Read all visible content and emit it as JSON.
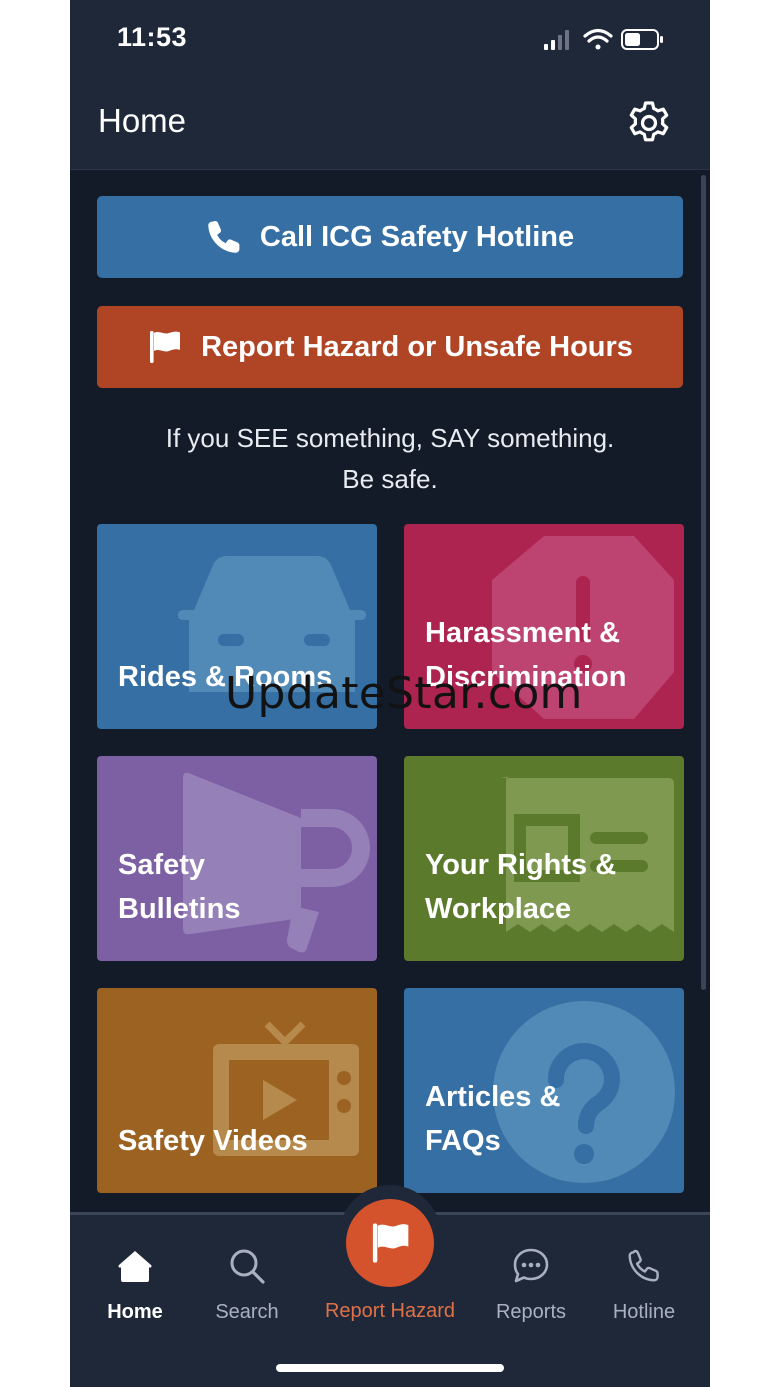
{
  "status_bar": {
    "time": "11:53"
  },
  "header": {
    "title": "Home"
  },
  "actions": {
    "hotline_label": "Call ICG Safety Hotline",
    "report_label": "Report Hazard or Unsafe Hours"
  },
  "tagline": "If you SEE something, SAY something.\nBe safe.",
  "tiles": [
    {
      "label": "Rides & Rooms",
      "color": "#356fa3",
      "icon": "car-icon"
    },
    {
      "label": "Harassment &\nDiscrimination",
      "color": "#ad2451",
      "icon": "stop-alert-icon"
    },
    {
      "label": "Safety\nBulletins",
      "color": "#7d5fa3",
      "icon": "megaphone-icon"
    },
    {
      "label": "Your Rights &\nWorkplace",
      "color": "#5c7a2c",
      "icon": "id-card-icon"
    },
    {
      "label": "Safety Videos",
      "color": "#9c6221",
      "icon": "tv-play-icon"
    },
    {
      "label": "Articles &\nFAQs",
      "color": "#356fa3",
      "icon": "question-icon"
    }
  ],
  "watermark": "UpdateStar.com",
  "tab_bar": {
    "tabs": [
      {
        "label": "Home",
        "icon": "home-icon",
        "active": true
      },
      {
        "label": "Search",
        "icon": "search-icon",
        "active": false
      },
      {
        "label": "Report Hazard",
        "icon": "flag-icon",
        "active": false
      },
      {
        "label": "Reports",
        "icon": "chat-bubble-icon",
        "active": false
      },
      {
        "label": "Hotline",
        "icon": "phone-icon",
        "active": false
      }
    ]
  },
  "colors": {
    "background": "#131b29",
    "bar": "#1f2839",
    "hotline": "#356fa3",
    "report": "#b04526",
    "accent": "#d4522c"
  }
}
